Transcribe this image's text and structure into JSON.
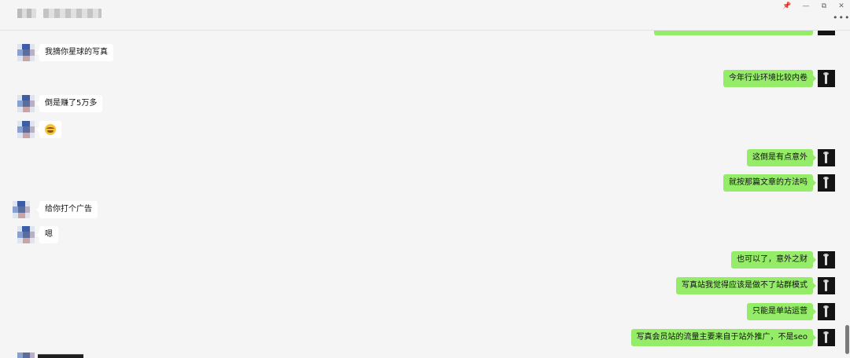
{
  "window": {
    "controls": {
      "pin_icon": "pin-icon",
      "minimize_label": "—",
      "maximize_label": "⧉",
      "close_label": "✕",
      "more_label": "•••"
    }
  },
  "chat": {
    "messages": [
      {
        "side": "left",
        "text": "我摘你星球的写真"
      },
      {
        "side": "right",
        "text": "今年行业环境比较内卷"
      },
      {
        "side": "left",
        "text": "倒是赚了5万多"
      },
      {
        "side": "left",
        "emoji": "grinning-emoji"
      },
      {
        "side": "right",
        "text": "这倒是有点意外"
      },
      {
        "side": "right",
        "text": "就按那篇文章的方法吗"
      },
      {
        "side": "left",
        "text": "给你打个广告"
      },
      {
        "side": "left",
        "text": "嗯"
      },
      {
        "side": "right",
        "text": "也可以了，意外之财"
      },
      {
        "side": "right",
        "text": "写真站我觉得应该是做不了站群模式"
      },
      {
        "side": "right",
        "text": "只能是单站运营"
      },
      {
        "side": "right",
        "text": "写真会员站的流量主要来自于站外推广，不是seo"
      }
    ]
  },
  "colors": {
    "background": "#f5f5f5",
    "bubble_self": "#95ec69",
    "bubble_other": "#ffffff"
  }
}
